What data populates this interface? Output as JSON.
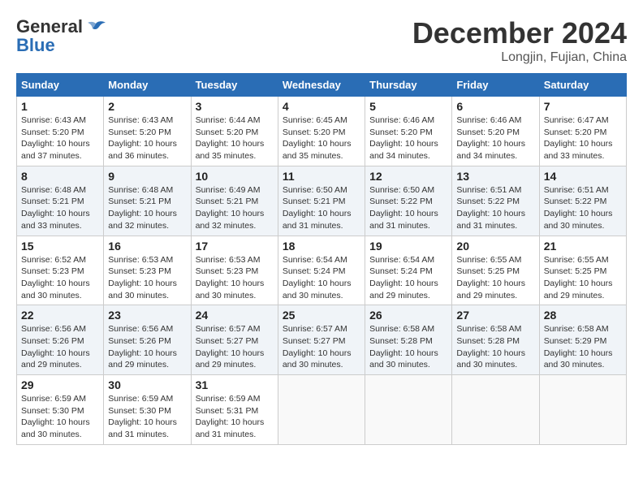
{
  "header": {
    "logo_line1": "General",
    "logo_line2": "Blue",
    "month": "December 2024",
    "location": "Longjin, Fujian, China"
  },
  "weekdays": [
    "Sunday",
    "Monday",
    "Tuesday",
    "Wednesday",
    "Thursday",
    "Friday",
    "Saturday"
  ],
  "weeks": [
    [
      {
        "day": "1",
        "sunrise": "6:43 AM",
        "sunset": "5:20 PM",
        "daylight": "10 hours and 37 minutes."
      },
      {
        "day": "2",
        "sunrise": "6:43 AM",
        "sunset": "5:20 PM",
        "daylight": "10 hours and 36 minutes."
      },
      {
        "day": "3",
        "sunrise": "6:44 AM",
        "sunset": "5:20 PM",
        "daylight": "10 hours and 35 minutes."
      },
      {
        "day": "4",
        "sunrise": "6:45 AM",
        "sunset": "5:20 PM",
        "daylight": "10 hours and 35 minutes."
      },
      {
        "day": "5",
        "sunrise": "6:46 AM",
        "sunset": "5:20 PM",
        "daylight": "10 hours and 34 minutes."
      },
      {
        "day": "6",
        "sunrise": "6:46 AM",
        "sunset": "5:20 PM",
        "daylight": "10 hours and 34 minutes."
      },
      {
        "day": "7",
        "sunrise": "6:47 AM",
        "sunset": "5:20 PM",
        "daylight": "10 hours and 33 minutes."
      }
    ],
    [
      {
        "day": "8",
        "sunrise": "6:48 AM",
        "sunset": "5:21 PM",
        "daylight": "10 hours and 33 minutes."
      },
      {
        "day": "9",
        "sunrise": "6:48 AM",
        "sunset": "5:21 PM",
        "daylight": "10 hours and 32 minutes."
      },
      {
        "day": "10",
        "sunrise": "6:49 AM",
        "sunset": "5:21 PM",
        "daylight": "10 hours and 32 minutes."
      },
      {
        "day": "11",
        "sunrise": "6:50 AM",
        "sunset": "5:21 PM",
        "daylight": "10 hours and 31 minutes."
      },
      {
        "day": "12",
        "sunrise": "6:50 AM",
        "sunset": "5:22 PM",
        "daylight": "10 hours and 31 minutes."
      },
      {
        "day": "13",
        "sunrise": "6:51 AM",
        "sunset": "5:22 PM",
        "daylight": "10 hours and 31 minutes."
      },
      {
        "day": "14",
        "sunrise": "6:51 AM",
        "sunset": "5:22 PM",
        "daylight": "10 hours and 30 minutes."
      }
    ],
    [
      {
        "day": "15",
        "sunrise": "6:52 AM",
        "sunset": "5:23 PM",
        "daylight": "10 hours and 30 minutes."
      },
      {
        "day": "16",
        "sunrise": "6:53 AM",
        "sunset": "5:23 PM",
        "daylight": "10 hours and 30 minutes."
      },
      {
        "day": "17",
        "sunrise": "6:53 AM",
        "sunset": "5:23 PM",
        "daylight": "10 hours and 30 minutes."
      },
      {
        "day": "18",
        "sunrise": "6:54 AM",
        "sunset": "5:24 PM",
        "daylight": "10 hours and 30 minutes."
      },
      {
        "day": "19",
        "sunrise": "6:54 AM",
        "sunset": "5:24 PM",
        "daylight": "10 hours and 29 minutes."
      },
      {
        "day": "20",
        "sunrise": "6:55 AM",
        "sunset": "5:25 PM",
        "daylight": "10 hours and 29 minutes."
      },
      {
        "day": "21",
        "sunrise": "6:55 AM",
        "sunset": "5:25 PM",
        "daylight": "10 hours and 29 minutes."
      }
    ],
    [
      {
        "day": "22",
        "sunrise": "6:56 AM",
        "sunset": "5:26 PM",
        "daylight": "10 hours and 29 minutes."
      },
      {
        "day": "23",
        "sunrise": "6:56 AM",
        "sunset": "5:26 PM",
        "daylight": "10 hours and 29 minutes."
      },
      {
        "day": "24",
        "sunrise": "6:57 AM",
        "sunset": "5:27 PM",
        "daylight": "10 hours and 29 minutes."
      },
      {
        "day": "25",
        "sunrise": "6:57 AM",
        "sunset": "5:27 PM",
        "daylight": "10 hours and 30 minutes."
      },
      {
        "day": "26",
        "sunrise": "6:58 AM",
        "sunset": "5:28 PM",
        "daylight": "10 hours and 30 minutes."
      },
      {
        "day": "27",
        "sunrise": "6:58 AM",
        "sunset": "5:28 PM",
        "daylight": "10 hours and 30 minutes."
      },
      {
        "day": "28",
        "sunrise": "6:58 AM",
        "sunset": "5:29 PM",
        "daylight": "10 hours and 30 minutes."
      }
    ],
    [
      {
        "day": "29",
        "sunrise": "6:59 AM",
        "sunset": "5:30 PM",
        "daylight": "10 hours and 30 minutes."
      },
      {
        "day": "30",
        "sunrise": "6:59 AM",
        "sunset": "5:30 PM",
        "daylight": "10 hours and 31 minutes."
      },
      {
        "day": "31",
        "sunrise": "6:59 AM",
        "sunset": "5:31 PM",
        "daylight": "10 hours and 31 minutes."
      },
      null,
      null,
      null,
      null
    ]
  ]
}
